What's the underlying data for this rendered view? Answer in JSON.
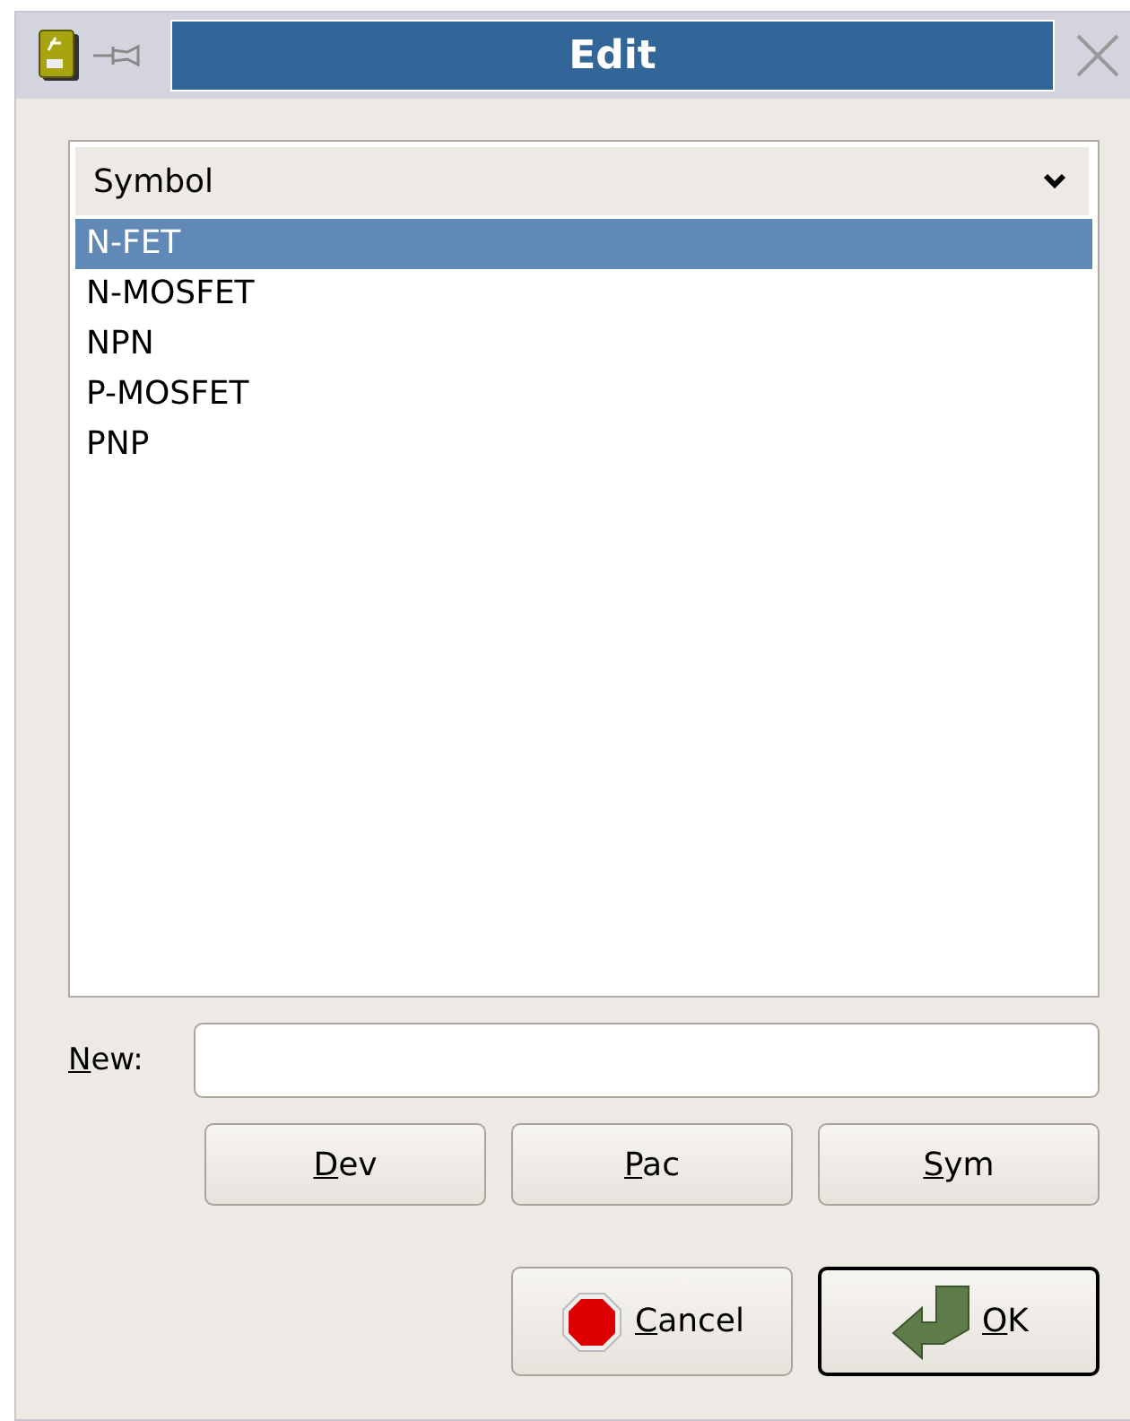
{
  "window": {
    "title": "Edit"
  },
  "list": {
    "header": "Symbol",
    "items": [
      {
        "label": "N-FET",
        "selected": true
      },
      {
        "label": "N-MOSFET",
        "selected": false
      },
      {
        "label": "NPN",
        "selected": false
      },
      {
        "label": "P-MOSFET",
        "selected": false
      },
      {
        "label": "PNP",
        "selected": false
      }
    ]
  },
  "new_field": {
    "label": "New:",
    "mnemonic": true
  },
  "buttons": [
    {
      "label": "Dev",
      "mnemonic": true
    },
    {
      "label": "Pac",
      "mnemonic": true
    },
    {
      "label": "Sym",
      "mnemonic": true
    }
  ],
  "dialog_buttons": [
    {
      "kind": "cancel",
      "label": "Cancel",
      "mnemonic": true,
      "default": false
    },
    {
      "kind": "ok",
      "label": "OK",
      "mnemonic": true,
      "default": true
    }
  ]
}
